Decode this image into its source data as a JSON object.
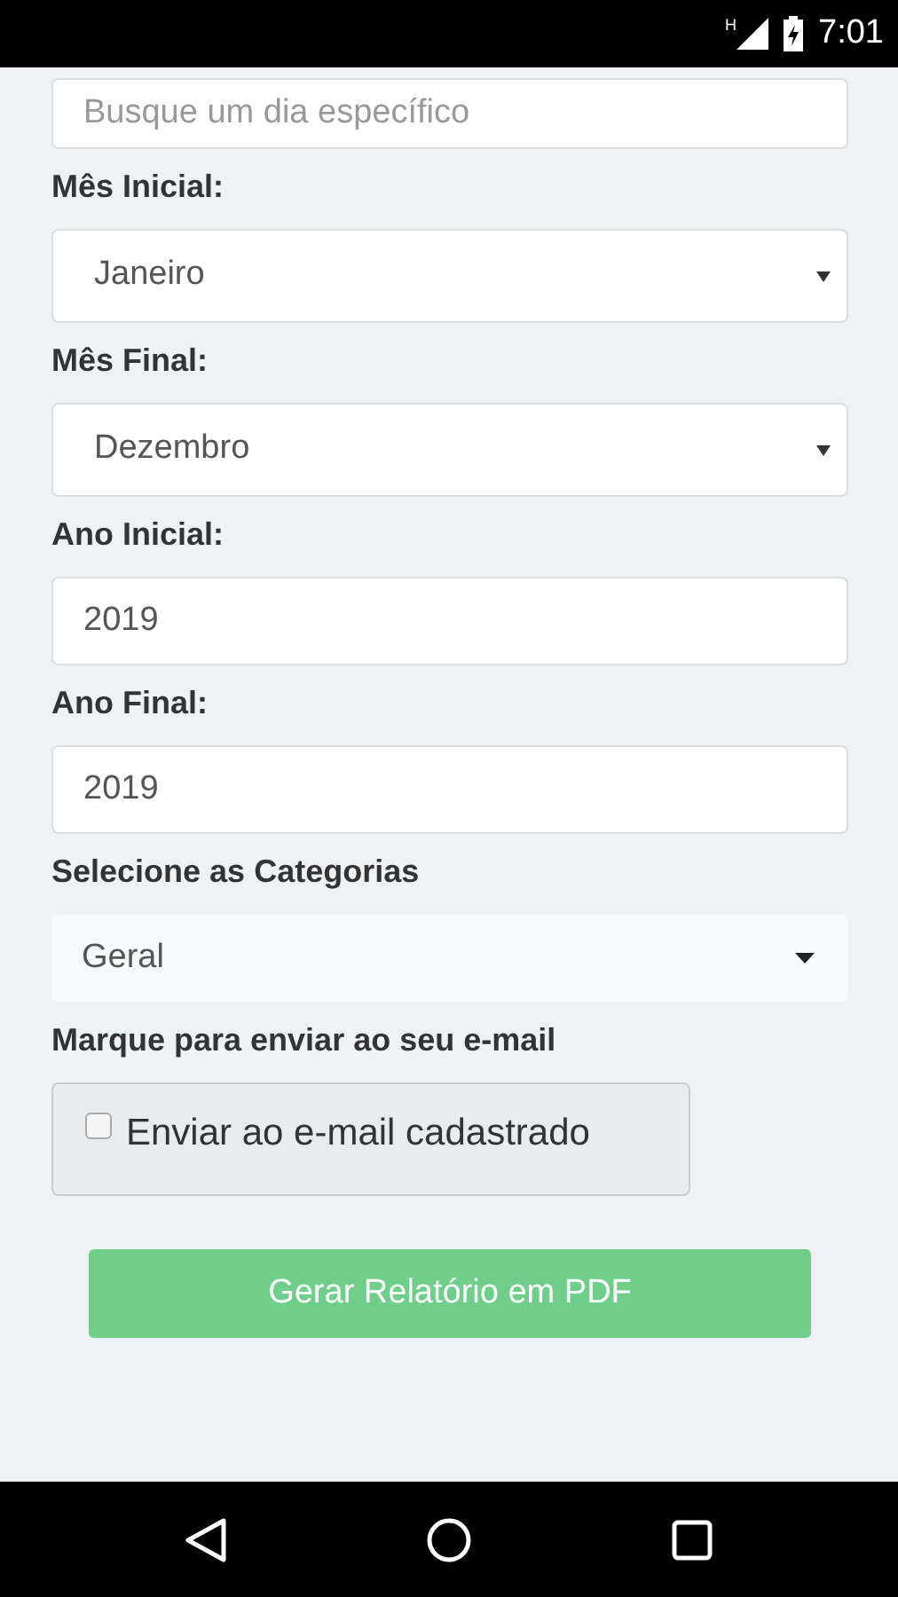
{
  "status_bar": {
    "time": "7:01",
    "network": "H"
  },
  "form": {
    "fields": [
      {
        "kind": "text",
        "placeholder": "Busque um dia específico"
      },
      {
        "kind": "label",
        "text": "Mês Inicial:"
      },
      {
        "kind": "select",
        "value": "Janeiro"
      },
      {
        "kind": "label",
        "text": "Mês Final:"
      },
      {
        "kind": "select",
        "value": "Dezembro"
      },
      {
        "kind": "label",
        "text": "Ano Inicial:"
      },
      {
        "kind": "text",
        "value": "2019"
      },
      {
        "kind": "label",
        "text": "Ano Final:"
      },
      {
        "kind": "text",
        "value": "2019"
      },
      {
        "kind": "label",
        "text": "Selecione as Categorias"
      },
      {
        "kind": "dropdown",
        "value": "Geral"
      },
      {
        "kind": "label",
        "text": "Marque para enviar ao seu e-mail"
      },
      {
        "kind": "checkbox",
        "text": "Enviar ao e-mail cadastrado",
        "checked": false
      }
    ],
    "submit": {
      "label": "Gerar Relatório em PDF",
      "disabled": true
    }
  }
}
